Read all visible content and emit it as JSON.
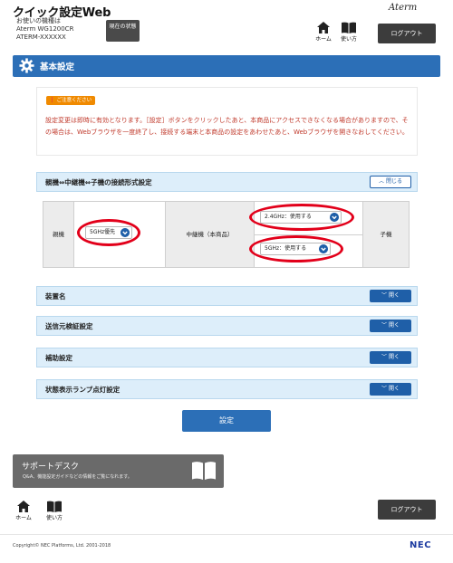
{
  "header": {
    "app_title": "クイック設定Web",
    "device_label": "お使いの機種は",
    "device_model": "Aterm WG1200CR",
    "device_id": "ATERM-XXXXXX",
    "status_button": "現在の状態",
    "brand": "Aterm",
    "home_label": "ホーム",
    "howto_label": "使い方",
    "logout": "ログアウト"
  },
  "section": {
    "title": "基本設定"
  },
  "caution": {
    "tag": "ご注意ください",
    "text": "設定変更は即時に有効となります。［設定］ボタンをクリックしたあと、本商品にアクセスできなくなる場合がありますので、その場合は、Webブラウザを一度終了し、接続する端末と本商品の設定をあわせたあと、Webブラウザを開きなおしてください。"
  },
  "connection_panel": {
    "title": "親機⇔中継機⇔子機の接続形式設定",
    "toggle": "閉じる",
    "parent_label": "親機",
    "parent_value": "5GHz優先",
    "repeater_label": "中継機（本商品）",
    "repeater_24": "2.4GHz：使用する",
    "repeater_5": "5GHz：使用する",
    "child_label": "子機"
  },
  "panels": [
    {
      "title": "装置名",
      "toggle": "開く"
    },
    {
      "title": "送信元検証設定",
      "toggle": "開く"
    },
    {
      "title": "補助設定",
      "toggle": "開く"
    },
    {
      "title": "状態表示ランプ点灯設定",
      "toggle": "開く"
    }
  ],
  "set_button": "設定",
  "support": {
    "title": "サポートデスク",
    "subtitle": "Q&A、機能設定ガイドなどの情報をご覧になれます。"
  },
  "footer": {
    "home_label": "ホーム",
    "howto_label": "使い方",
    "logout": "ログアウト",
    "copyright": "Copyright© NEC Platforms, Ltd. 2001-2018",
    "brand": "NEC"
  },
  "colors": {
    "accent": "#2c6fb7",
    "caution_text": "#c0392b",
    "caution_tag": "#f08a00",
    "highlight": "#e2001a"
  }
}
